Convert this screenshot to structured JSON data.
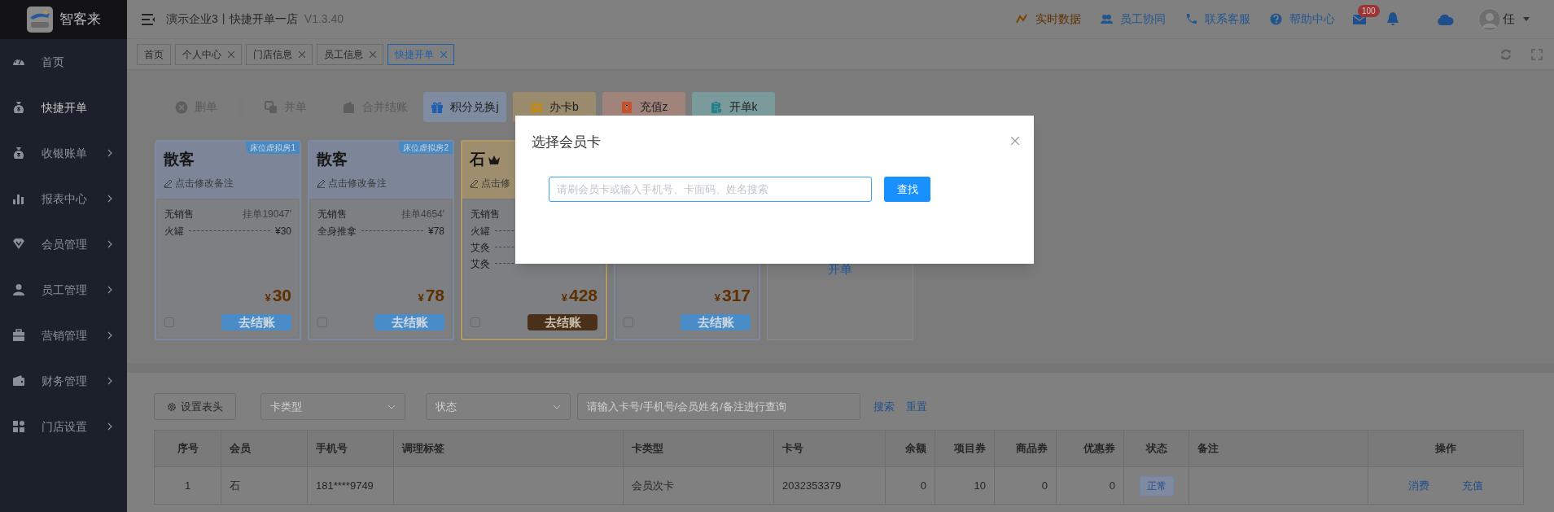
{
  "sidebar": {
    "brand": "智客来",
    "items": [
      {
        "label": "首页",
        "selected": false,
        "expandable": false
      },
      {
        "label": "快捷开单",
        "selected": true,
        "expandable": false
      },
      {
        "label": "收银账单",
        "selected": false,
        "expandable": true
      },
      {
        "label": "报表中心",
        "selected": false,
        "expandable": true
      },
      {
        "label": "会员管理",
        "selected": false,
        "expandable": true
      },
      {
        "label": "员工管理",
        "selected": false,
        "expandable": true
      },
      {
        "label": "营销管理",
        "selected": false,
        "expandable": true
      },
      {
        "label": "财务管理",
        "selected": false,
        "expandable": true
      },
      {
        "label": "门店设置",
        "selected": false,
        "expandable": true
      }
    ]
  },
  "header": {
    "title": "演示企业3丨快捷开单一店",
    "version": "V1.3.40",
    "links": [
      {
        "label": "实时数据",
        "kind": "realtime"
      },
      {
        "label": "员工协同",
        "kind": "staff"
      },
      {
        "label": "联系客服",
        "kind": "phone"
      },
      {
        "label": "帮助中心",
        "kind": "help"
      }
    ],
    "mail_badge": "100",
    "user": "任"
  },
  "tabs": [
    {
      "label": "首页",
      "closable": false,
      "selected": false
    },
    {
      "label": "个人中心",
      "closable": true,
      "selected": false
    },
    {
      "label": "门店信息",
      "closable": true,
      "selected": false
    },
    {
      "label": "员工信息",
      "closable": true,
      "selected": false
    },
    {
      "label": "快捷开单",
      "closable": true,
      "selected": true
    }
  ],
  "toolbar": [
    {
      "label": "删单",
      "kind": "delete"
    },
    {
      "label": "并单",
      "kind": "merge"
    },
    {
      "label": "合并结账",
      "kind": "mergepay"
    },
    {
      "label": "积分兑换j",
      "kind": "points"
    },
    {
      "label": "办卡b",
      "kind": "card"
    },
    {
      "label": "充值z",
      "kind": "recharge"
    },
    {
      "label": "开单k",
      "kind": "open"
    }
  ],
  "cards": [
    {
      "kind": "guest",
      "name": "散客",
      "room": "床位虚拟房1",
      "note": "点击修改备注",
      "seller": "无销售",
      "order": "挂单19047′",
      "items": [
        {
          "name": "火罐",
          "price": "¥30"
        }
      ],
      "currency": "¥",
      "total": "30",
      "pay": "去结账",
      "checked": false
    },
    {
      "kind": "guest",
      "name": "散客",
      "room": "床位虚拟房2",
      "note": "点击修改备注",
      "seller": "无销售",
      "order": "挂单4654′",
      "items": [
        {
          "name": "全身推拿",
          "price": "¥78"
        }
      ],
      "currency": "¥",
      "total": "78",
      "pay": "去结账",
      "checked": false
    },
    {
      "kind": "member",
      "name": "石",
      "note": "点击修",
      "seller": "无销售",
      "items": [
        {
          "name": "火罐"
        },
        {
          "name": "艾灸"
        },
        {
          "name": "艾灸"
        }
      ],
      "currency": "¥",
      "total": "428",
      "pay": "去结账",
      "checked": false
    },
    {
      "kind": "guest",
      "currency": "¥",
      "total": "317",
      "pay": "去结账",
      "checked": false
    },
    {
      "kind": "add",
      "label": "开单"
    }
  ],
  "dialog": {
    "title": "选择会员卡",
    "placeholder": "请刷会员卡或输入手机号、卡面码、姓名搜索",
    "button": "查找"
  },
  "filters": {
    "settings": "设置表头",
    "card_type": "卡类型",
    "status": "状态",
    "search": {
      "placeholder": "请输入卡号/手机号/会员姓名/备注进行查询"
    },
    "links": [
      "搜索",
      "重置"
    ]
  },
  "table": {
    "columns": [
      "序号",
      "会员",
      "手机号",
      "调理标签",
      "卡类型",
      "卡号",
      "余额",
      "项目券",
      "商品券",
      "优惠券",
      "状态",
      "备注",
      "操作"
    ],
    "rows": [
      {
        "index": "1",
        "member": "石",
        "phone": "181****9749",
        "card_type": "会员次卡",
        "card_no": "2032353379",
        "balance": "0",
        "project_coupons": "10",
        "goods_coupons": "0",
        "discount_coupons": "0",
        "status": "正常",
        "actions": [
          "消费",
          "充值"
        ]
      }
    ]
  }
}
